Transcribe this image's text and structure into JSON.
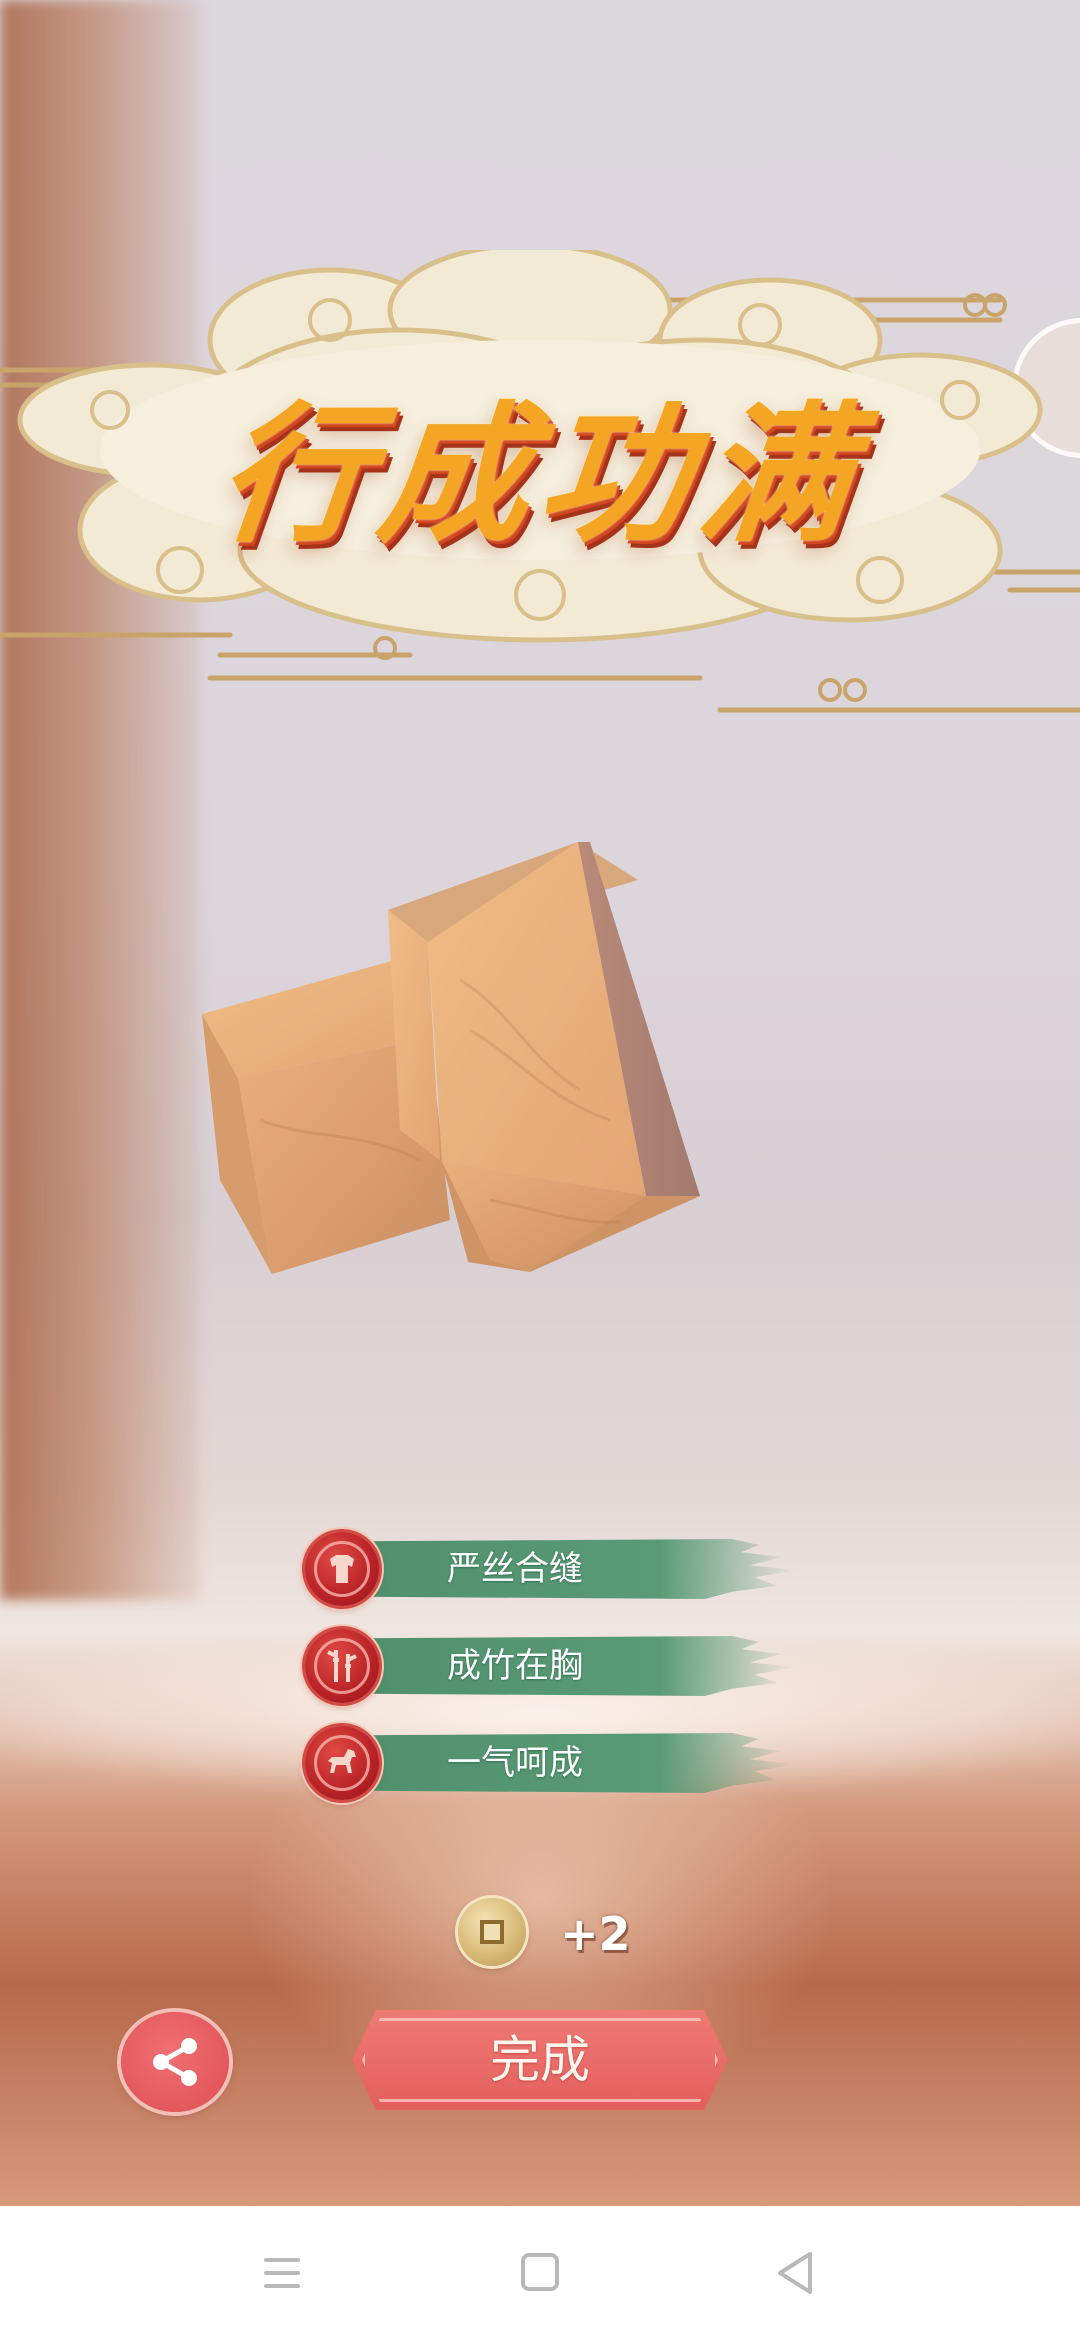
{
  "title": {
    "text": "行成功满"
  },
  "achievements": [
    {
      "label": "严丝合缝",
      "icon": "armor-icon"
    },
    {
      "label": "成竹在胸",
      "icon": "bamboo-icon"
    },
    {
      "label": "一气呵成",
      "icon": "horse-icon"
    }
  ],
  "reward": {
    "icon": "coin-icon",
    "amount": "+2"
  },
  "buttons": {
    "share_icon": "share-icon",
    "done_label": "完成"
  },
  "colors": {
    "ribbon_green": "#5a9b77",
    "badge_red": "#b82226",
    "button_red": "#e35f5c",
    "title_gold": "#f4a524"
  },
  "nav": {
    "items": [
      "menu-icon",
      "home-icon",
      "back-icon"
    ]
  }
}
